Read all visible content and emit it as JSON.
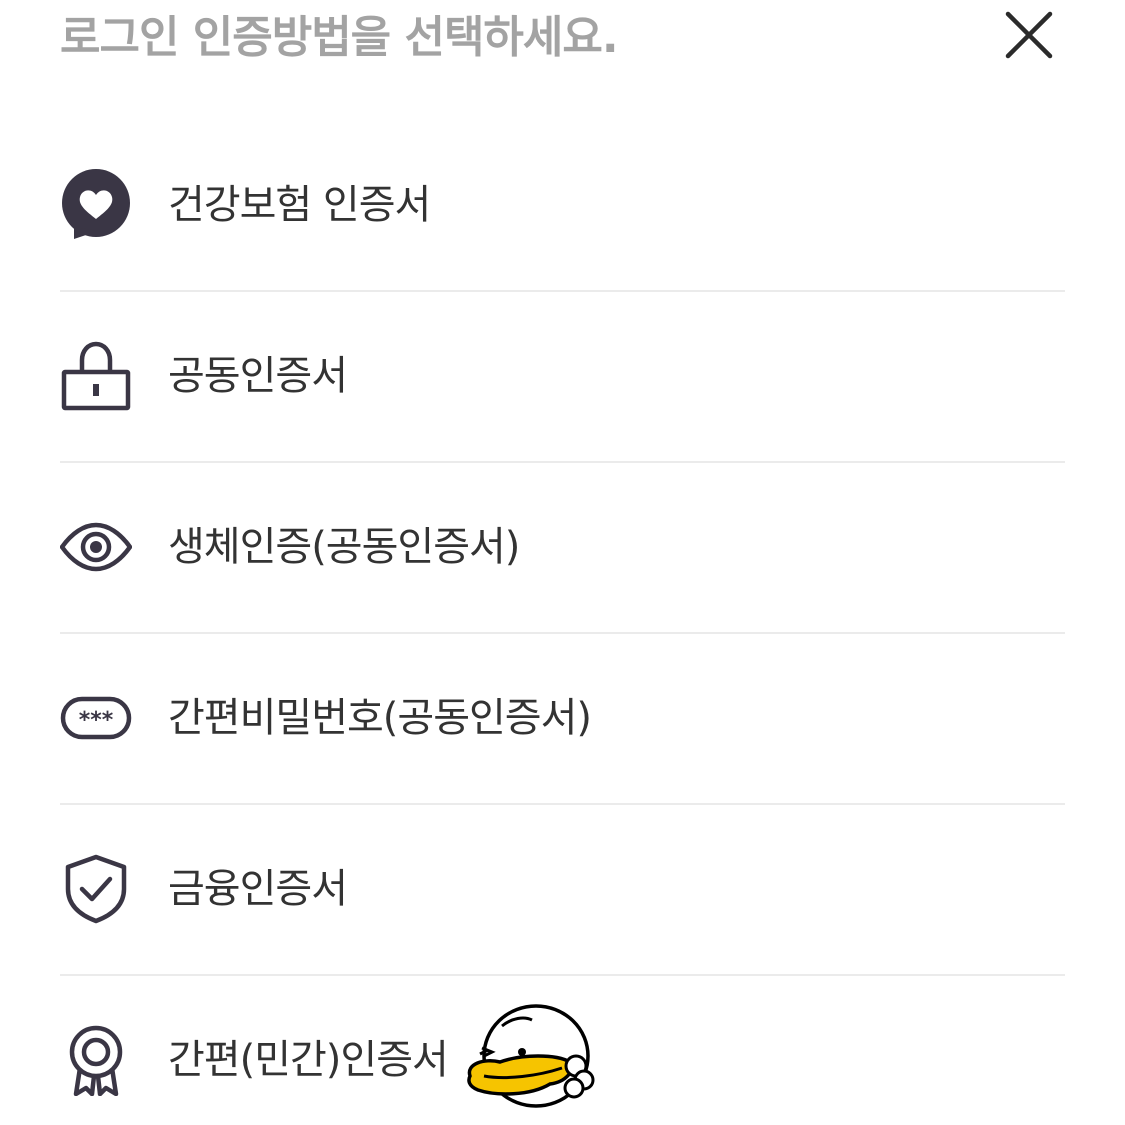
{
  "header": {
    "title": "로그인 인증방법을 선택하세요.",
    "close_icon": "close-icon"
  },
  "methods": [
    {
      "label": "건강보험 인증서",
      "icon": "nhis-heart-bubble-icon"
    },
    {
      "label": "공동인증서",
      "icon": "lock-icon"
    },
    {
      "label": "생체인증(공동인증서)",
      "icon": "eye-icon"
    },
    {
      "label": "간편비밀번호(공동인증서)",
      "icon": "password-dots-icon"
    },
    {
      "label": "금융인증서",
      "icon": "shield-check-icon"
    },
    {
      "label": "간편(민간)인증서",
      "icon": "award-badge-icon",
      "mascot": "duck-mascot-icon"
    }
  ],
  "colors": {
    "icon": "#3a3645",
    "title": "#a3a3a3",
    "label": "#333333",
    "divider": "#ebebeb",
    "mascot_beak": "#f6c400"
  }
}
